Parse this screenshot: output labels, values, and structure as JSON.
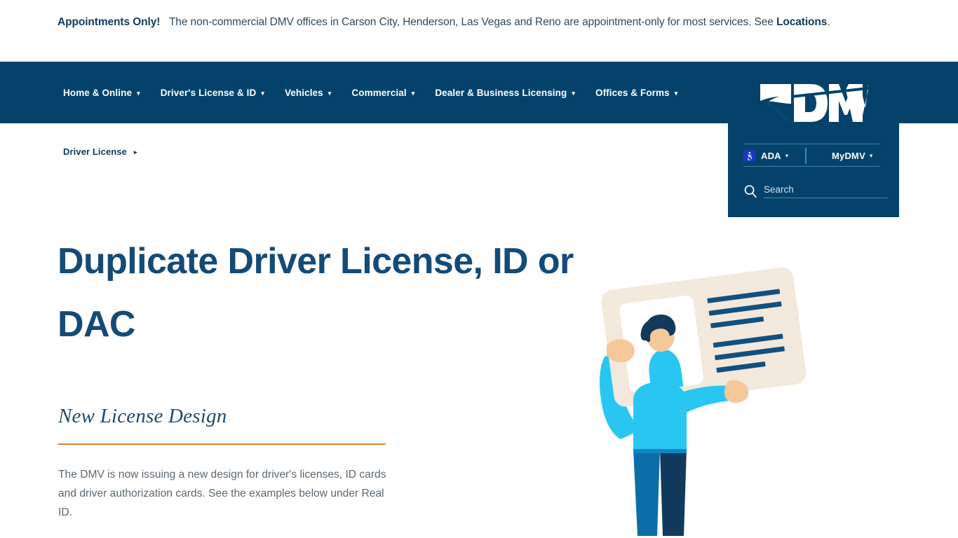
{
  "alert": {
    "strong": "Appointments Only!",
    "body": "The non-commercial DMV offices in Carson City, Henderson, Las Vegas and Reno are appointment-only for most services. See ",
    "link": "Locations",
    "period": "."
  },
  "nav": {
    "items": [
      {
        "label": "Home & Online",
        "caret": "▾"
      },
      {
        "label": "Driver's License & ID",
        "caret": "▾"
      },
      {
        "label": "Vehicles",
        "caret": "▾"
      },
      {
        "label": "Commercial",
        "caret": "▾"
      },
      {
        "label": "Dealer & Business Licensing",
        "caret": "▾"
      },
      {
        "label": "Offices & Forms",
        "caret": "▾"
      }
    ]
  },
  "utility": {
    "logo_alt": "DMV",
    "ada_label": "ADA",
    "ada_caret": "▾",
    "mydmv_label": "MyDMV",
    "mydmv_caret": "▾",
    "search_placeholder": "Search",
    "search_value": ""
  },
  "breadcrumb": {
    "item": "Driver License",
    "arrow": "▸"
  },
  "main": {
    "title": "Duplicate Driver License, ID or DAC",
    "section_heading": "New License Design",
    "section_body": "The DMV is now issuing a new design for driver's licenses, ID cards and driver authorization cards. See the examples below under Real ID."
  },
  "colors": {
    "nav_blue": "#04426b",
    "heading_blue": "#144a77",
    "accent_orange": "#d8822f",
    "body_gray": "#5b6770",
    "ada_blue": "#1a36c4",
    "illustration_cyan": "#29c6f2",
    "illustration_card": "#f3e8dc",
    "illustration_navy": "#123a5c",
    "illustration_jeans": "#0b6ea8",
    "illustration_skin": "#f5c89a"
  }
}
